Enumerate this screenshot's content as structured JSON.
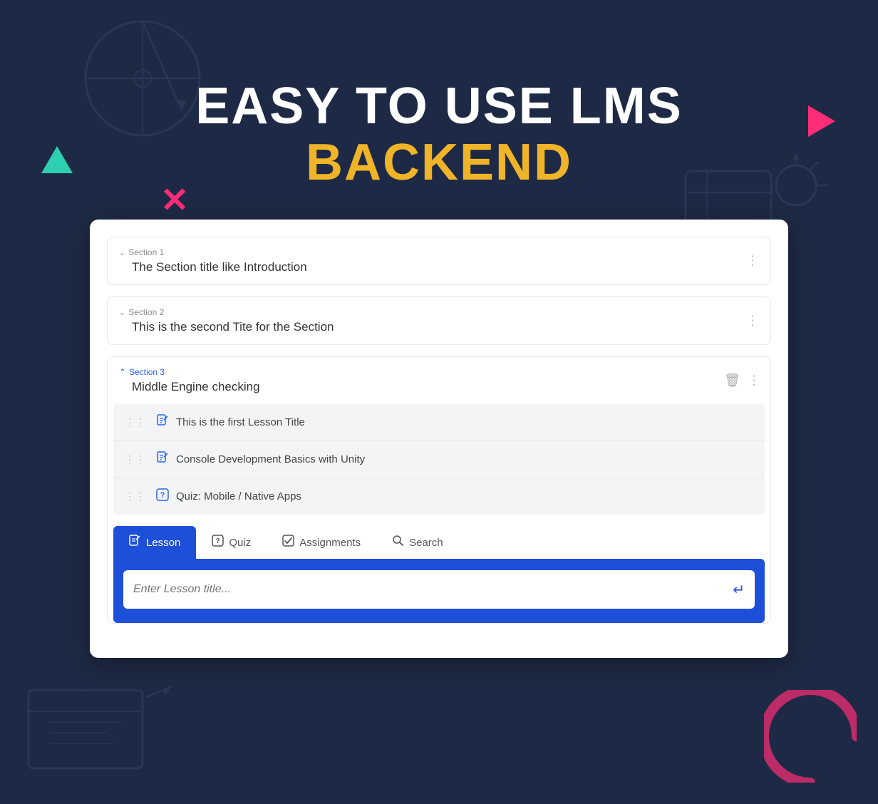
{
  "hero": {
    "line1": "EASY TO USE LMS",
    "line2": "BACKEND"
  },
  "sections": [
    {
      "id": "section1",
      "label": "Section 1",
      "title": "The Section title like Introduction",
      "expanded": false
    },
    {
      "id": "section2",
      "label": "Section 2",
      "title": "This is the second Tite for the Section",
      "expanded": false
    },
    {
      "id": "section3",
      "label": "Section 3",
      "title": "Middle Engine checking",
      "expanded": true
    }
  ],
  "lessonItems": [
    {
      "type": "lesson",
      "text": "This is the first Lesson Title"
    },
    {
      "type": "lesson",
      "text": "Console Development Basics with Unity"
    },
    {
      "type": "quiz",
      "text": "Quiz: Mobile / Native Apps"
    }
  ],
  "tabs": [
    {
      "id": "lesson",
      "label": "Lesson",
      "active": true
    },
    {
      "id": "quiz",
      "label": "Quiz",
      "active": false
    },
    {
      "id": "assignments",
      "label": "Assignments",
      "active": false
    },
    {
      "id": "search",
      "label": "Search",
      "active": false
    }
  ],
  "inputPlaceholder": "Enter Lesson title...",
  "colors": {
    "accent": "#1e4fd8",
    "yellow": "#f0b429",
    "pink": "#ff2d78",
    "teal": "#2ecfb0"
  }
}
